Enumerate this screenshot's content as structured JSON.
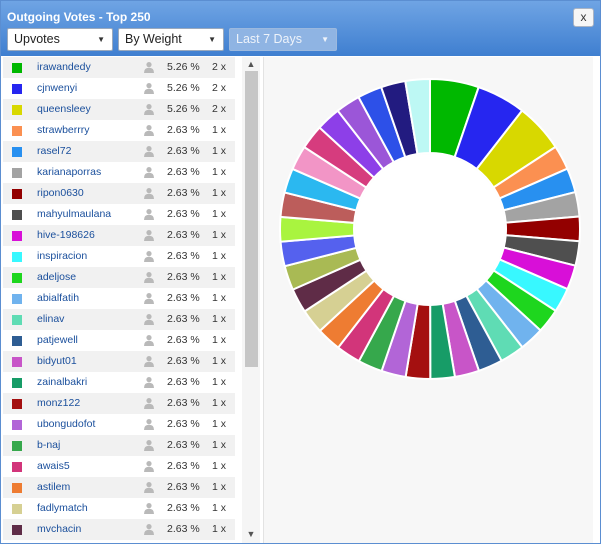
{
  "window": {
    "title": "Outgoing Votes - Top 250",
    "close_label": "x"
  },
  "filters": {
    "vote_type": "Upvotes",
    "sort": "By Weight",
    "period": "Last 7 Days"
  },
  "chart_data": {
    "type": "pie",
    "donut": true,
    "categories": [
      "irawandedy",
      "cjnwenyi",
      "queensleey",
      "strawberrry",
      "rasel72",
      "karianaporras",
      "ripon0630",
      "mahyulmaulana",
      "hive-198626",
      "inspiracion",
      "adeljose",
      "abialfatih",
      "elinav",
      "patjewell",
      "bidyut01",
      "zainalbakri",
      "monz122",
      "ubongudofot",
      "b-naj",
      "awais5",
      "astilem",
      "fadlymatch",
      "mvchacin"
    ],
    "values": [
      5.26,
      5.26,
      5.26,
      2.63,
      2.63,
      2.63,
      2.63,
      2.63,
      2.63,
      2.63,
      2.63,
      2.63,
      2.63,
      2.63,
      2.63,
      2.63,
      2.63,
      2.63,
      2.63,
      2.63,
      2.63,
      2.63,
      2.63
    ],
    "counts": [
      2,
      2,
      2,
      1,
      1,
      1,
      1,
      1,
      1,
      1,
      1,
      1,
      1,
      1,
      1,
      1,
      1,
      1,
      1,
      1,
      1,
      1,
      1
    ],
    "colors": [
      "#00b800",
      "#2626f0",
      "#d8d800",
      "#fb9051",
      "#2890f0",
      "#a3a3a3",
      "#930000",
      "#4f4f4f",
      "#d80fd8",
      "#38f8ff",
      "#1ed61e",
      "#70b3ee",
      "#5fdcb4",
      "#2e5d93",
      "#c855c8",
      "#179c67",
      "#a41010",
      "#b265d7",
      "#36a84c",
      "#d2357a",
      "#ee7c32",
      "#d6d093",
      "#5f2c47"
    ],
    "extra_slice_colors": [
      "#a9ba54",
      "#5561ee",
      "#a9f43f",
      "#bc5d5b",
      "#2bb8f0",
      "#f295c6",
      "#d63c7e",
      "#8d3fe8",
      "#9b56d8",
      "#2d50e8",
      "#221b80",
      "#bdf8f4"
    ]
  },
  "rows": [
    {
      "name": "irawandedy",
      "pct": "5.26 %",
      "count": "2 x"
    },
    {
      "name": "cjnwenyi",
      "pct": "5.26 %",
      "count": "2 x"
    },
    {
      "name": "queensleey",
      "pct": "5.26 %",
      "count": "2 x"
    },
    {
      "name": "strawberrry",
      "pct": "2.63 %",
      "count": "1 x"
    },
    {
      "name": "rasel72",
      "pct": "2.63 %",
      "count": "1 x"
    },
    {
      "name": "karianaporras",
      "pct": "2.63 %",
      "count": "1 x"
    },
    {
      "name": "ripon0630",
      "pct": "2.63 %",
      "count": "1 x"
    },
    {
      "name": "mahyulmaulana",
      "pct": "2.63 %",
      "count": "1 x"
    },
    {
      "name": "hive-198626",
      "pct": "2.63 %",
      "count": "1 x"
    },
    {
      "name": "inspiracion",
      "pct": "2.63 %",
      "count": "1 x"
    },
    {
      "name": "adeljose",
      "pct": "2.63 %",
      "count": "1 x"
    },
    {
      "name": "abialfatih",
      "pct": "2.63 %",
      "count": "1 x"
    },
    {
      "name": "elinav",
      "pct": "2.63 %",
      "count": "1 x"
    },
    {
      "name": "patjewell",
      "pct": "2.63 %",
      "count": "1 x"
    },
    {
      "name": "bidyut01",
      "pct": "2.63 %",
      "count": "1 x"
    },
    {
      "name": "zainalbakri",
      "pct": "2.63 %",
      "count": "1 x"
    },
    {
      "name": "monz122",
      "pct": "2.63 %",
      "count": "1 x"
    },
    {
      "name": "ubongudofot",
      "pct": "2.63 %",
      "count": "1 x"
    },
    {
      "name": "b-naj",
      "pct": "2.63 %",
      "count": "1 x"
    },
    {
      "name": "awais5",
      "pct": "2.63 %",
      "count": "1 x"
    },
    {
      "name": "astilem",
      "pct": "2.63 %",
      "count": "1 x"
    },
    {
      "name": "fadlymatch",
      "pct": "2.63 %",
      "count": "1 x"
    },
    {
      "name": "mvchacin",
      "pct": "2.63 %",
      "count": "1 x"
    }
  ],
  "icons": {
    "user": "user-icon",
    "dropdown": "chevron-down-icon",
    "scroll_up": "scroll-up-arrow-icon",
    "scroll_down": "scroll-down-arrow-icon"
  }
}
